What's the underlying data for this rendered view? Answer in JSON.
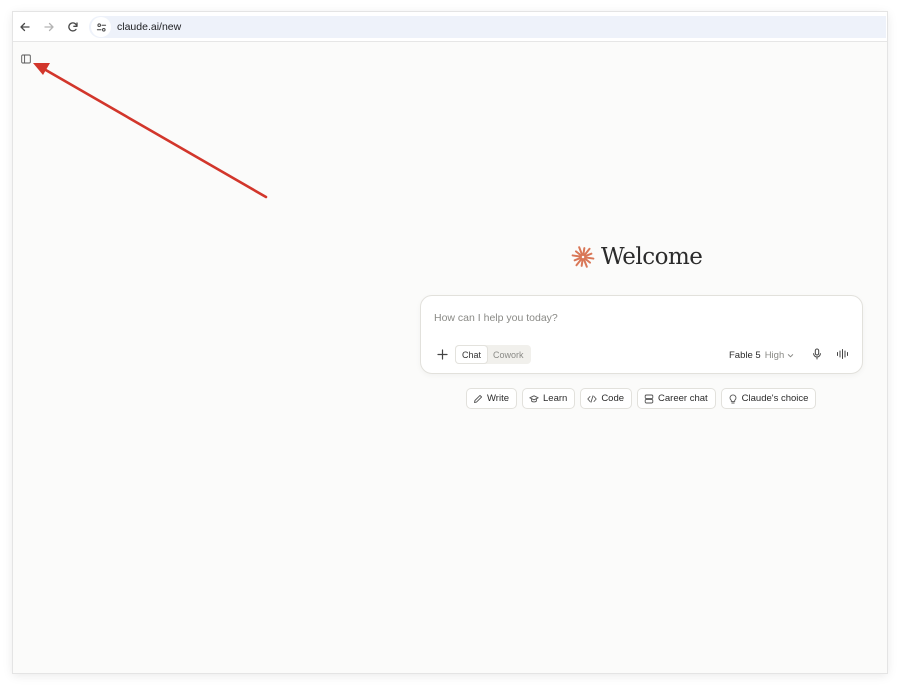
{
  "browser": {
    "url": "claude.ai/new",
    "back_icon": "arrow-left-icon",
    "forward_icon": "arrow-right-icon",
    "reload_icon": "reload-icon",
    "site_info_icon": "site-settings-icon"
  },
  "sidebar": {
    "toggle_icon": "sidebar-toggle-icon"
  },
  "main": {
    "logo_icon": "claude-spark-icon",
    "logo_color": "#d97757",
    "greeting": "Welcome"
  },
  "composer": {
    "placeholder": "How can I help you today?",
    "modes": [
      "Chat",
      "Cowork"
    ],
    "active_mode": "Chat",
    "model_name": "Fable 5",
    "model_effort": "High"
  },
  "chips": [
    {
      "label": "Write",
      "icon": "pencil-icon"
    },
    {
      "label": "Learn",
      "icon": "graduation-cap-icon"
    },
    {
      "label": "Code",
      "icon": "code-icon"
    },
    {
      "label": "Career chat",
      "icon": "briefcase-icon"
    },
    {
      "label": "Claude's choice",
      "icon": "lightbulb-icon"
    }
  ],
  "annotation": {
    "color": "#d2362b"
  }
}
